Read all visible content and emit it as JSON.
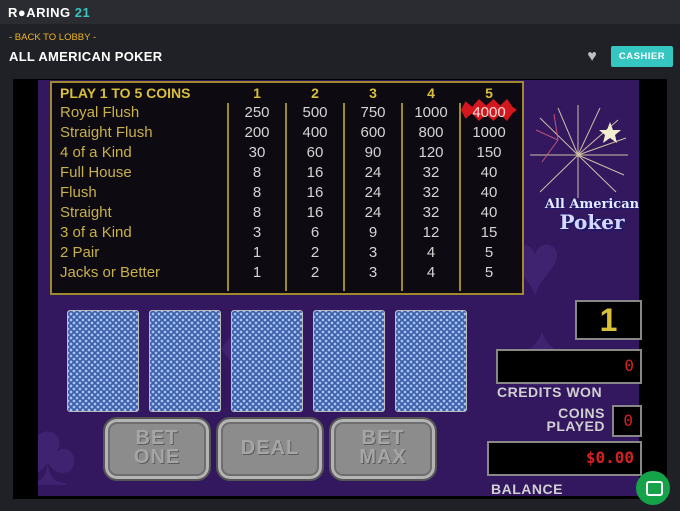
{
  "header": {
    "logo_text_left": "R",
    "logo_text_mid": "ARING ",
    "logo_text_num": "21",
    "logo_icon": "gear-dot-icon"
  },
  "nav": {
    "back": "- BACK TO LOBBY -",
    "title": "ALL AMERICAN POKER",
    "favorite_icon": "heart-icon",
    "cashier": "CASHIER"
  },
  "paytable": {
    "header": "PLAY 1 TO 5 COINS",
    "coins": [
      "1",
      "2",
      "3",
      "4",
      "5"
    ],
    "rows": [
      {
        "hand": "Royal Flush",
        "values": [
          "250",
          "500",
          "750",
          "1000",
          "4000"
        ]
      },
      {
        "hand": "Straight Flush",
        "values": [
          "200",
          "400",
          "600",
          "800",
          "1000"
        ]
      },
      {
        "hand": "4 of a Kind",
        "values": [
          "30",
          "60",
          "90",
          "120",
          "150"
        ]
      },
      {
        "hand": "Full House",
        "values": [
          "8",
          "16",
          "24",
          "32",
          "40"
        ]
      },
      {
        "hand": "Flush",
        "values": [
          "8",
          "16",
          "24",
          "32",
          "40"
        ]
      },
      {
        "hand": "Straight",
        "values": [
          "8",
          "16",
          "24",
          "32",
          "40"
        ]
      },
      {
        "hand": "3 of a Kind",
        "values": [
          "3",
          "6",
          "9",
          "12",
          "15"
        ]
      },
      {
        "hand": "2 Pair",
        "values": [
          "1",
          "2",
          "3",
          "4",
          "5"
        ]
      },
      {
        "hand": "Jacks or Better",
        "values": [
          "1",
          "2",
          "3",
          "4",
          "5"
        ]
      }
    ]
  },
  "logo": {
    "line1": "All American",
    "line2": "Poker"
  },
  "buttons": {
    "bet_one": [
      "BET",
      "ONE"
    ],
    "deal": "DEAL",
    "bet_max": [
      "BET",
      "MAX"
    ]
  },
  "meters": {
    "bet_level": "1",
    "credits_won": "0",
    "credits_won_label": "CREDITS WON",
    "coins_played": "0",
    "coins_played_label": [
      "COINS",
      "PLAYED"
    ],
    "balance": "$0.00",
    "balance_label": "BALANCE"
  },
  "colors": {
    "accent": "#35c6c1",
    "felt": "#34185f",
    "gold": "#d9bf3a",
    "red": "#d42020"
  }
}
